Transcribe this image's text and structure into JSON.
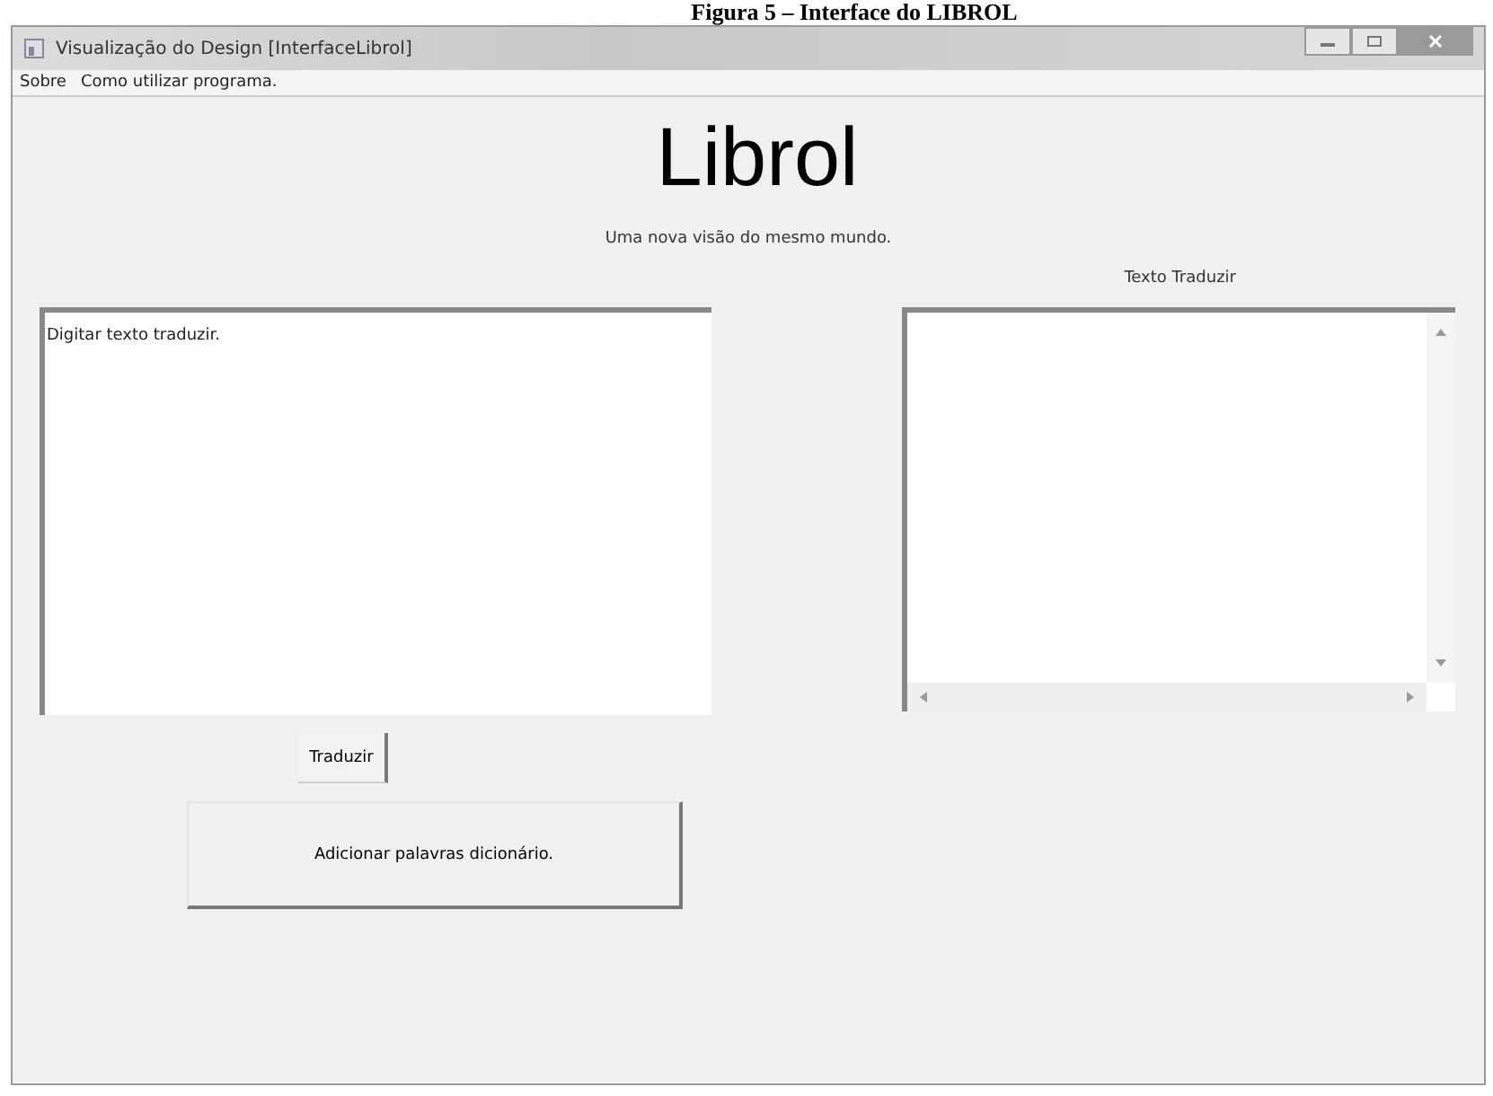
{
  "caption": "Figura 5 – Interface do LIBROL",
  "window": {
    "title": "Visualização do Design [InterfaceLibrol]"
  },
  "menu": [
    "Sobre",
    "Como utilizar programa."
  ],
  "heading": "Librol",
  "subtitle": "Uma nova visão do mesmo mundo.",
  "output_label": "Texto Traduzir",
  "input": {
    "value": "Digitar texto traduzir."
  },
  "buttons": {
    "translate": "Traduzir",
    "add_words": "Adicionar palavras dicionário."
  }
}
